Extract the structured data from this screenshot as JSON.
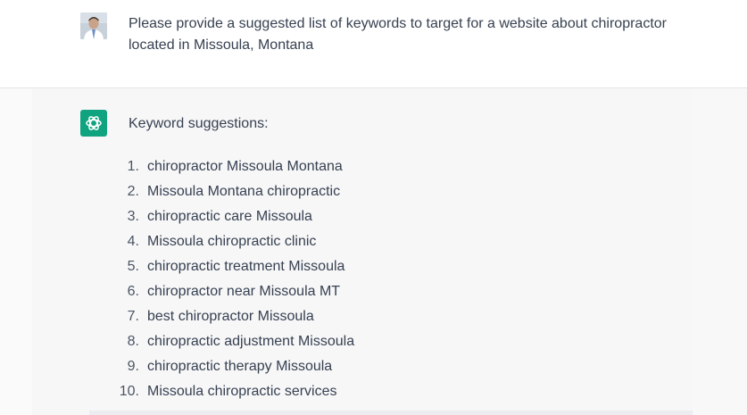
{
  "user_message": {
    "avatar_icon": "user-photo-avatar",
    "text": "Please provide a suggested list of keywords to target for a website about chiropractor located in Missoula, Montana"
  },
  "assistant_message": {
    "avatar_icon": "openai-logo-icon",
    "avatar_color": "#10a37f",
    "intro": "Keyword suggestions:",
    "keywords": [
      {
        "num": "1.",
        "text": "chiropractor Missoula Montana"
      },
      {
        "num": "2.",
        "text": "Missoula Montana chiropractic"
      },
      {
        "num": "3.",
        "text": "chiropractic care Missoula"
      },
      {
        "num": "4.",
        "text": "Missoula chiropractic clinic"
      },
      {
        "num": "5.",
        "text": "chiropractic treatment Missoula"
      },
      {
        "num": "6.",
        "text": "chiropractor near Missoula MT"
      },
      {
        "num": "7.",
        "text": "best chiropractor Missoula"
      },
      {
        "num": "8.",
        "text": "chiropractic adjustment Missoula"
      },
      {
        "num": "9.",
        "text": "chiropractic therapy Missoula"
      },
      {
        "num": "10.",
        "text": "Missoula chiropractic services"
      }
    ]
  }
}
